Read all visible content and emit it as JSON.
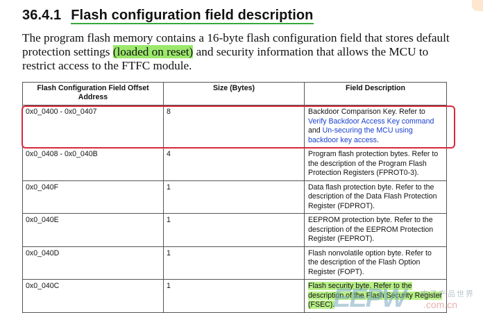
{
  "heading": {
    "number": "36.4.1",
    "title": "Flash configuration field description"
  },
  "paragraph": {
    "before": "The program flash memory contains a 16-byte flash configuration field that stores default protection settings ",
    "highlight": "(loaded on reset)",
    "after": " and security information that allows the MCU to restrict access to the FTFC module."
  },
  "table": {
    "headers": [
      "Flash Configuration Field Offset Address",
      "Size (Bytes)",
      "Field Description"
    ],
    "rows": [
      {
        "offset": "0x0_0400 - 0x0_0407",
        "size": "8",
        "desc_before": "Backdoor Comparison Key. Refer to ",
        "desc_link1": "Verify Backdoor Access Key command",
        "desc_mid": " and ",
        "desc_link2": "Un-securing the MCU using backdoor key access",
        "desc_after": "."
      },
      {
        "offset": "0x0_0408 - 0x0_040B",
        "size": "4",
        "desc": "Program flash protection bytes. Refer to the description of the Program Flash Protection Registers (FPROT0-3)."
      },
      {
        "offset": "0x0_040F",
        "size": "1",
        "desc": "Data flash protection byte. Refer to the description of the Data Flash Protection Register (FDPROT)."
      },
      {
        "offset": "0x0_040E",
        "size": "1",
        "desc": "EEPROM protection byte. Refer to the description of the EEPROM Protection Register (FEPROT)."
      },
      {
        "offset": "0x0_040D",
        "size": "1",
        "desc": "Flash nonvolatile option byte. Refer to the description of the Flash Option Register (FOPT)."
      },
      {
        "offset": "0x0_040C",
        "size": "1",
        "desc": "Flash security byte. Refer to the description of the Flash Security Register (FSEC)."
      }
    ]
  },
  "watermark": {
    "logo": "EEPW",
    "cn_text": "电子产品世界",
    "domain": ".com.cn"
  },
  "colors": {
    "heading_underline": "#37a83a",
    "highlight": "#9be86b",
    "link": "#1a3fcf",
    "annotation_box": "#d8283c"
  }
}
